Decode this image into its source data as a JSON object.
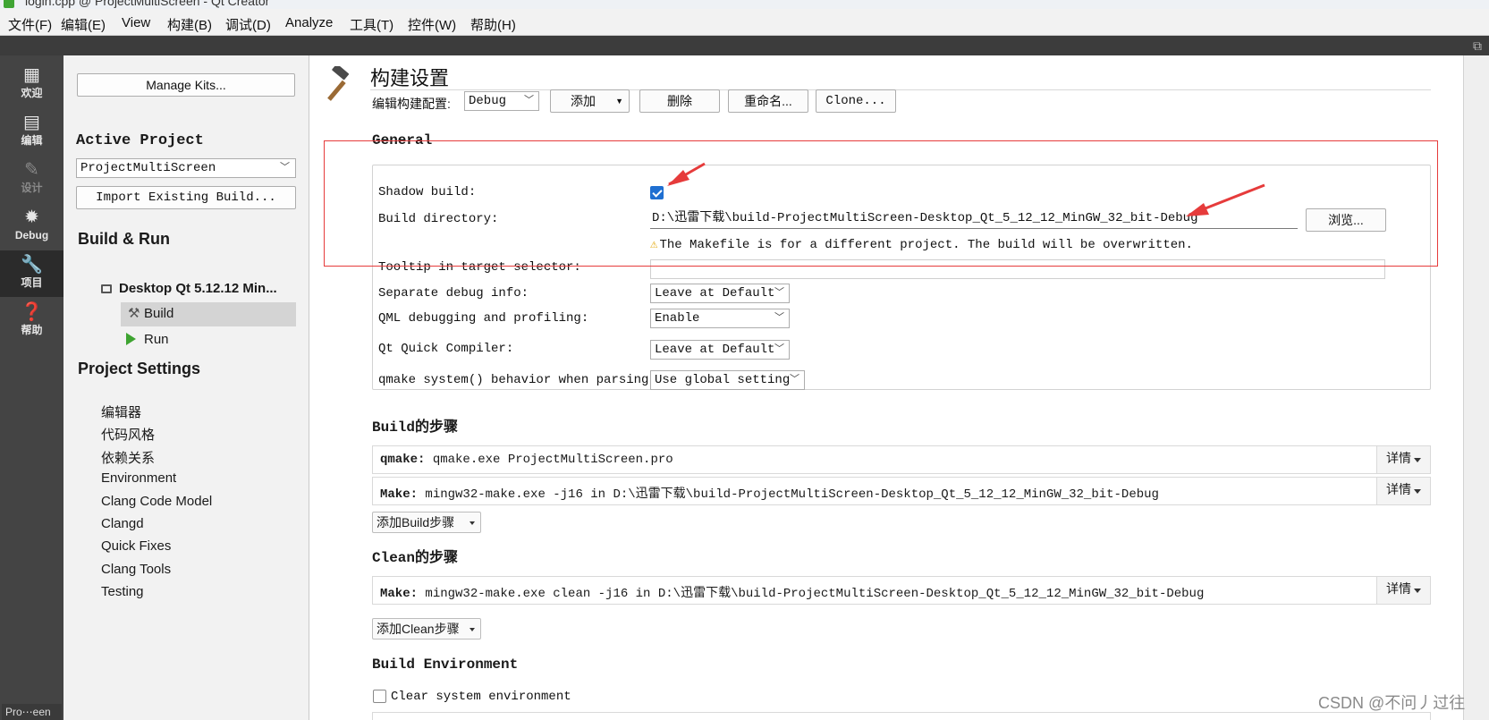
{
  "window": {
    "title": "login.cpp @ ProjectMultiScreen - Qt Creator"
  },
  "menu": [
    "文件(F)",
    "编辑(E)",
    "View",
    "构建(B)",
    "调试(D)",
    "Analyze",
    "工具(T)",
    "控件(W)",
    "帮助(H)"
  ],
  "modes": [
    {
      "label": "欢迎",
      "icon": "welcome-grid-icon",
      "glyph": "▦"
    },
    {
      "label": "编辑",
      "icon": "edit-document-icon",
      "glyph": "▤"
    },
    {
      "label": "设计",
      "icon": "design-pen-icon",
      "glyph": "✎"
    },
    {
      "label": "Debug",
      "icon": "debug-bug-icon",
      "glyph": "✹"
    },
    {
      "label": "项目",
      "icon": "projects-wrench-icon",
      "glyph": "🔧"
    },
    {
      "label": "帮助",
      "icon": "help-question-icon",
      "glyph": "❓"
    }
  ],
  "modebar_project": "Pro⋯een",
  "left": {
    "manage_kits": "Manage Kits...",
    "active_project_title": "Active Project",
    "active_project": "ProjectMultiScreen",
    "import_build": "Import Existing Build...",
    "build_run_title": "Build & Run",
    "kit": "Desktop Qt 5.12.12 Min...",
    "build": "Build",
    "run": "Run",
    "project_settings_title": "Project Settings",
    "settings": [
      "编辑器",
      "代码风格",
      "依赖关系",
      "Environment",
      "Clang Code Model",
      "Clangd",
      "Quick Fixes",
      "Clang Tools",
      "Testing"
    ]
  },
  "main": {
    "title": "构建设置",
    "edit_config_label": "编辑构建配置:",
    "config_value": "Debug",
    "add": "添加",
    "delete": "删除",
    "rename": "重命名...",
    "clone": "Clone...",
    "general_title": "General",
    "shadow_label": "Shadow build:",
    "shadow_checked": true,
    "builddir_label": "Build directory:",
    "builddir_value": "D:\\迅雷下载\\build-ProjectMultiScreen-Desktop_Qt_5_12_12_MinGW_32_bit-Debug",
    "browse": "浏览...",
    "warning": "The Makefile is for a different project. The build will be overwritten.",
    "tooltip_label": "Tooltip in target selector:",
    "tooltip_value": "",
    "sepdebug_label": "Separate debug info:",
    "sepdebug_value": "Leave at Default",
    "qml_label": "QML debugging and profiling:",
    "qml_value": "Enable",
    "qtquick_label": "Qt Quick Compiler:",
    "qtquick_value": "Leave at Default",
    "qmake_label": "qmake system() behavior when parsing:",
    "qmake_value": "Use global setting",
    "build_steps_title": "Build的步骤",
    "step1_key": "qmake:",
    "step1_val": " qmake.exe ProjectMultiScreen.pro",
    "step2_key": "Make:",
    "step2_val": " mingw32-make.exe -j16 in D:\\迅雷下载\\build-ProjectMultiScreen-Desktop_Qt_5_12_12_MinGW_32_bit-Debug",
    "details": "详情",
    "add_build_step": "添加Build步骤",
    "clean_steps_title": "Clean的步骤",
    "clean_key": "Make:",
    "clean_val": " mingw32-make.exe clean -j16 in D:\\迅雷下载\\build-ProjectMultiScreen-Desktop_Qt_5_12_12_MinGW_32_bit-Debug",
    "add_clean_step": "添加Clean步骤",
    "build_env_title": "Build Environment",
    "clear_env_label": "Clear system environment",
    "clear_env_checked": false
  },
  "watermark": "CSDN @不问丿过往",
  "colors": {
    "annotation": "#e63b3b",
    "accent": "#1f6fd1",
    "run": "#3ea431",
    "modebar": "#444444"
  }
}
